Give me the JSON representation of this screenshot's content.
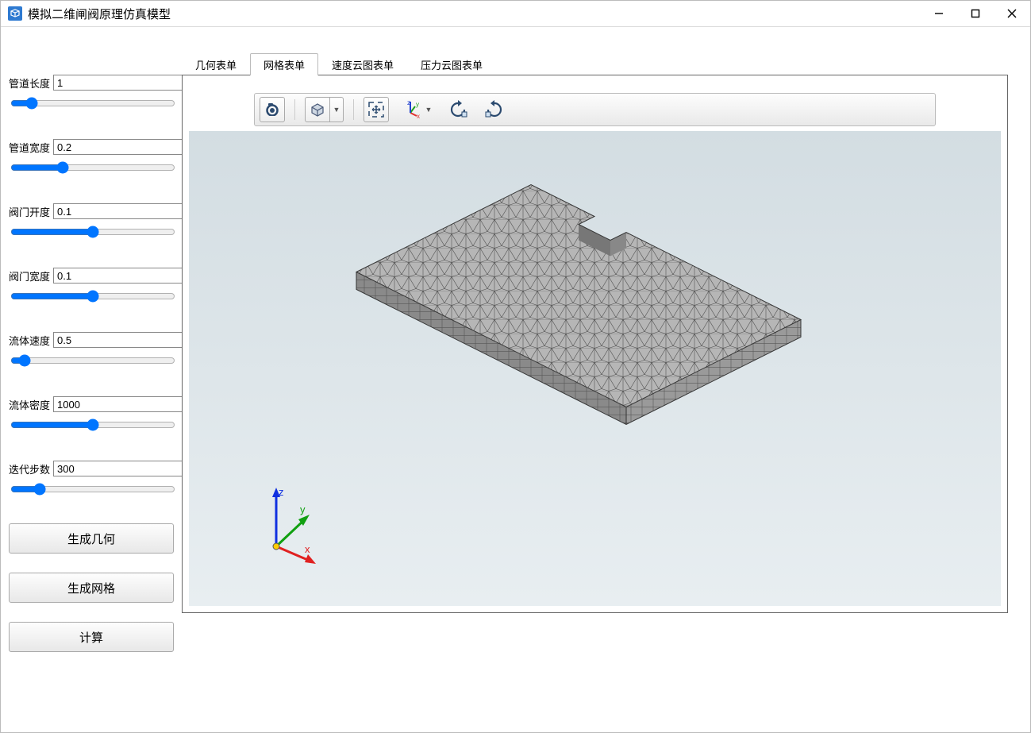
{
  "title": "模拟二维闸阀原理仿真模型",
  "params": [
    {
      "label": "管道长度",
      "value": "1",
      "slider": 10
    },
    {
      "label": "管道宽度",
      "value": "0.2",
      "slider": 30
    },
    {
      "label": "阀门开度",
      "value": "0.1",
      "slider": 50
    },
    {
      "label": "阀门宽度",
      "value": "0.1",
      "slider": 50
    },
    {
      "label": "流体速度",
      "value": "0.5",
      "slider": 5
    },
    {
      "label": "流体密度",
      "value": "1000",
      "slider": 50
    },
    {
      "label": "迭代步数",
      "value": "300",
      "slider": 15
    }
  ],
  "buttons": {
    "gen_geom": "生成几何",
    "gen_mesh": "生成网格",
    "compute": "计算"
  },
  "tabs": [
    {
      "label": "几何表单",
      "active": false
    },
    {
      "label": "网格表单",
      "active": true
    },
    {
      "label": "速度云图表单",
      "active": false
    },
    {
      "label": "压力云图表单",
      "active": false
    }
  ],
  "triad": {
    "x": "x",
    "y": "y",
    "z": "z"
  }
}
